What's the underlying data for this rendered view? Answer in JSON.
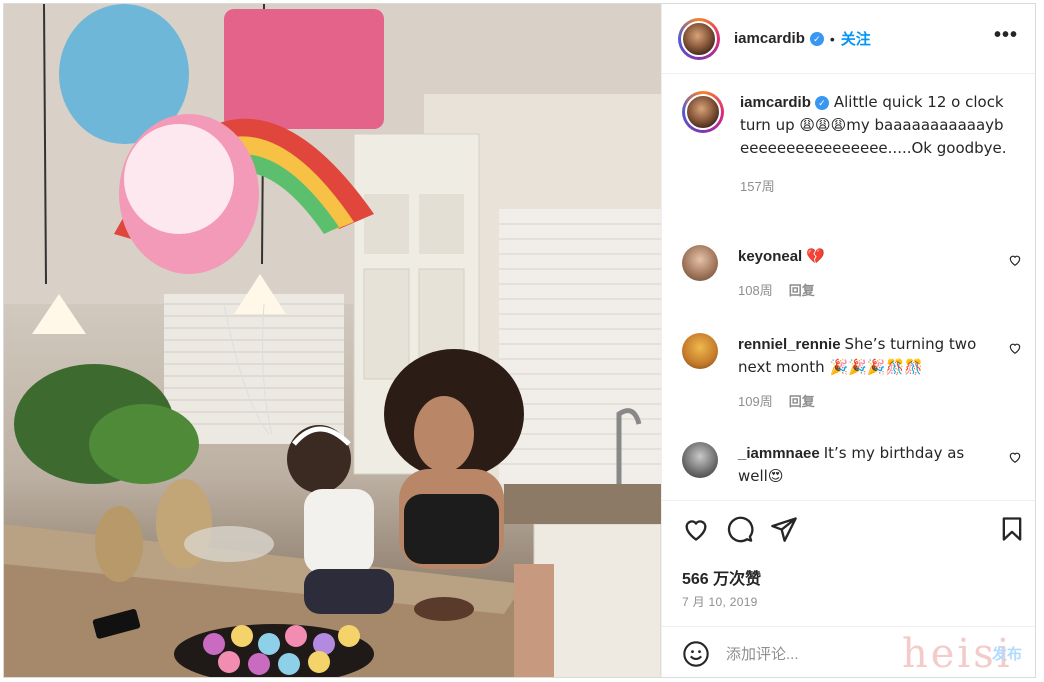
{
  "post": {
    "username": "iamcardib",
    "verified_mark": "✓",
    "separator": "•",
    "follow_label": "关注",
    "more_label": "•••"
  },
  "caption": {
    "username": "iamcardib",
    "text": "Alittle quick 12 o clock turn up 😩😩😩my baaaaaaaaaaaybeeeeeeeeeeeeeeee.....Ok goodbye.",
    "time": "157周"
  },
  "comments": [
    {
      "username": "keyoneal",
      "text": "💔",
      "time": "108周",
      "reply": "回复"
    },
    {
      "username": "renniel_rennie",
      "text": "She’s turning two next month 🎉🎉🎉🎊🎊",
      "time": "109周",
      "reply": "回复"
    },
    {
      "username": "_iammnaee",
      "text": "It’s my birthday as well😍"
    }
  ],
  "likes": "566 万次赞",
  "date": "7 月 10, 2019",
  "add_comment": {
    "placeholder": "添加评论...",
    "post_label": "发布"
  },
  "watermark": "heisi",
  "icons": [
    "heart-icon",
    "comment-icon",
    "share-icon",
    "bookmark-icon",
    "smile-icon",
    "more-icon",
    "verified-icon"
  ],
  "colors": {
    "accent": "#0095f6",
    "verified": "#3897f0",
    "muted": "#8e8e8e",
    "post_disabled": "#b3dbff"
  }
}
